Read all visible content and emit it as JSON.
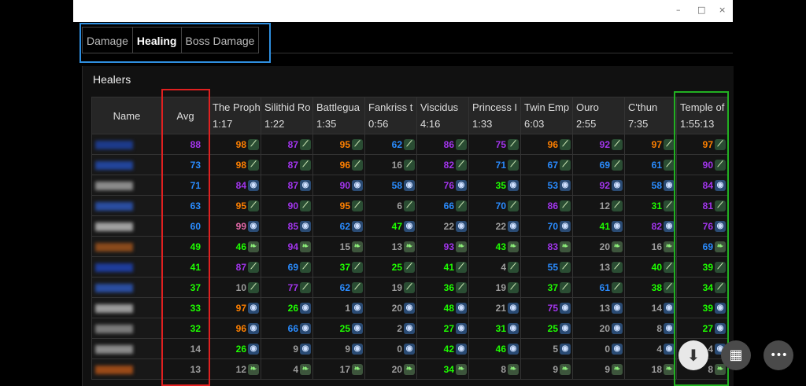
{
  "window": {
    "minimize": "–",
    "maximize": "□",
    "close": "×"
  },
  "tabs": [
    {
      "label": "Damage",
      "active": false
    },
    {
      "label": "Healing",
      "active": true
    },
    {
      "label": "Boss Damage",
      "active": false
    }
  ],
  "section_title": "Healers",
  "table": {
    "headers": {
      "name": "Name",
      "avg": "Avg",
      "bosses": [
        {
          "name": "The Proph",
          "time": "1:17"
        },
        {
          "name": "Silithid Ro",
          "time": "1:22"
        },
        {
          "name": "Battlegua",
          "time": "1:35"
        },
        {
          "name": "Fankriss t",
          "time": "0:56"
        },
        {
          "name": "Viscidus",
          "time": "4:16"
        },
        {
          "name": "Princess I",
          "time": "1:33"
        },
        {
          "name": "Twin Emp",
          "time": "6:03"
        },
        {
          "name": "Ouro",
          "time": "2:55"
        },
        {
          "name": "C'thun",
          "time": "7:35"
        },
        {
          "name": "Temple of",
          "time": "1:55:13"
        }
      ]
    },
    "rows": [
      {
        "name_color": "#1d3a8a",
        "avg": 88,
        "spec": "druid",
        "scores": [
          98,
          87,
          95,
          62,
          86,
          75,
          96,
          92,
          97,
          97
        ]
      },
      {
        "name_color": "#22449a",
        "avg": 73,
        "spec": "druid",
        "scores": [
          98,
          87,
          96,
          16,
          82,
          71,
          67,
          69,
          61,
          90
        ]
      },
      {
        "name_color": "#8a8a8a",
        "avg": 71,
        "spec": "shaman",
        "scores": [
          84,
          87,
          90,
          58,
          76,
          35,
          53,
          92,
          58,
          84
        ]
      },
      {
        "name_color": "#2a4da0",
        "avg": 63,
        "spec": "druid",
        "scores": [
          95,
          90,
          95,
          6,
          66,
          70,
          86,
          12,
          31,
          81
        ]
      },
      {
        "name_color": "#a0a0a0",
        "avg": 60,
        "spec": "shaman",
        "scores": [
          99,
          85,
          62,
          47,
          22,
          22,
          70,
          41,
          82,
          76
        ]
      },
      {
        "name_color": "#8a4a1c",
        "avg": 49,
        "spec": "priest",
        "scores": [
          46,
          94,
          15,
          13,
          93,
          43,
          83,
          20,
          16,
          69
        ]
      },
      {
        "name_color": "#1e3c9a",
        "avg": 41,
        "spec": "druid",
        "scores": [
          87,
          69,
          37,
          25,
          41,
          4,
          55,
          13,
          40,
          39
        ]
      },
      {
        "name_color": "#2a4da0",
        "avg": 37,
        "spec": "druid",
        "scores": [
          10,
          77,
          62,
          19,
          36,
          19,
          37,
          61,
          38,
          34
        ]
      },
      {
        "name_color": "#9a9a9a",
        "avg": 33,
        "spec": "shaman",
        "scores": [
          97,
          26,
          1,
          20,
          48,
          21,
          75,
          13,
          14,
          39
        ]
      },
      {
        "name_color": "#7a7a7a",
        "avg": 32,
        "spec": "shaman",
        "scores": [
          96,
          66,
          25,
          2,
          27,
          31,
          25,
          20,
          8,
          27
        ]
      },
      {
        "name_color": "#8a8a8a",
        "avg": 14,
        "spec": "shaman",
        "scores": [
          26,
          9,
          9,
          0,
          42,
          46,
          5,
          0,
          4,
          4
        ]
      },
      {
        "name_color": "#9a4a18",
        "avg": 13,
        "spec": "priest",
        "scores": [
          12,
          4,
          17,
          20,
          34,
          8,
          9,
          9,
          18,
          8
        ]
      }
    ]
  },
  "spec_icons": {
    "druid": "claw-icon",
    "shaman": "totem-icon",
    "priest": "leaf-icon"
  },
  "score_colors": {
    "orange": "#ff8000",
    "purple": "#a335ee",
    "blue": "#2a8cff",
    "green": "#1eff00",
    "gray": "#9d9d9d",
    "pink": "#e268a8"
  },
  "highlights": {
    "tabs": "#2f8fe0",
    "avg": "#e02020",
    "total": "#22b022"
  },
  "fabs": [
    {
      "name": "download-button",
      "glyph": "⬇"
    },
    {
      "name": "grid-button",
      "glyph": "▦"
    },
    {
      "name": "more-button",
      "glyph": "•••"
    }
  ]
}
